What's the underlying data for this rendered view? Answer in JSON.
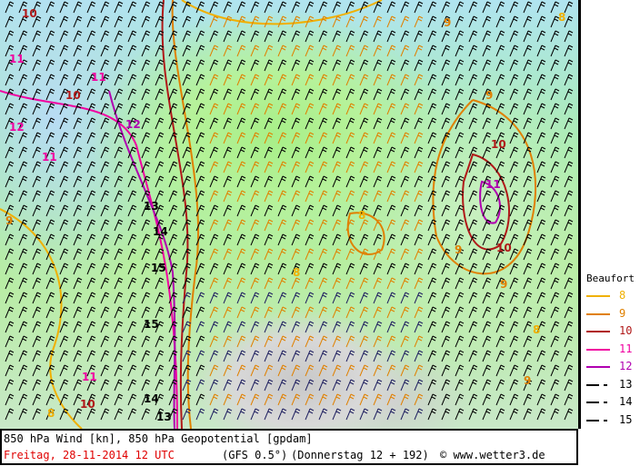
{
  "footer": {
    "title": "850 hPa Wind [kn], 850 hPa Geopotential [gpdam]",
    "date": "Freitag, 28-11-2014  12 UTC",
    "model": "(GFS 0.5°)",
    "run": "(Donnerstag 12 + 192)",
    "credit": "© www.wetter3.de"
  },
  "legend": {
    "title": "Beaufort",
    "items": [
      {
        "value": "8",
        "color": "#f0b000",
        "style": "solid"
      },
      {
        "value": "9",
        "color": "#e08000",
        "style": "solid"
      },
      {
        "value": "10",
        "color": "#b01818",
        "style": "solid"
      },
      {
        "value": "11",
        "color": "#f000a0",
        "style": "solid"
      },
      {
        "value": "12",
        "color": "#b000b0",
        "style": "solid"
      },
      {
        "value": "13",
        "color": "#000000",
        "style": "dashed"
      },
      {
        "value": "14",
        "color": "#000000",
        "style": "dashed"
      },
      {
        "value": "15",
        "color": "#000000",
        "style": "dashed"
      }
    ]
  },
  "map_labels": [
    {
      "text": "10",
      "color": "#b01818"
    },
    {
      "text": "11",
      "color": "#f000a0"
    },
    {
      "text": "12",
      "color": "#f000a0"
    },
    {
      "text": "11",
      "color": "#f000a0"
    },
    {
      "text": "10",
      "color": "#b01818"
    },
    {
      "text": "12",
      "color": "#b000b0"
    },
    {
      "text": "11",
      "color": "#f000a0"
    },
    {
      "text": "13",
      "color": "#000000"
    },
    {
      "text": "14",
      "color": "#000000"
    },
    {
      "text": "15",
      "color": "#000000"
    },
    {
      "text": "15",
      "color": "#000000"
    },
    {
      "text": "14",
      "color": "#000000"
    },
    {
      "text": "13",
      "color": "#000000"
    },
    {
      "text": "11",
      "color": "#f000a0"
    },
    {
      "text": "10",
      "color": "#b01818"
    },
    {
      "text": "9",
      "color": "#e08000"
    },
    {
      "text": "8",
      "color": "#f0b000"
    },
    {
      "text": "8",
      "color": "#f0b000"
    },
    {
      "text": "8",
      "color": "#f0b000"
    },
    {
      "text": "9",
      "color": "#e08000"
    },
    {
      "text": "9",
      "color": "#e08000"
    },
    {
      "text": "10",
      "color": "#b01818"
    },
    {
      "text": "11",
      "color": "#b000b0"
    },
    {
      "text": "10",
      "color": "#b01818"
    },
    {
      "text": "9",
      "color": "#e08000"
    },
    {
      "text": "9",
      "color": "#e08000"
    },
    {
      "text": "8",
      "color": "#f0b000"
    },
    {
      "text": "8",
      "color": "#f0b000"
    },
    {
      "text": "9",
      "color": "#e08000"
    }
  ]
}
